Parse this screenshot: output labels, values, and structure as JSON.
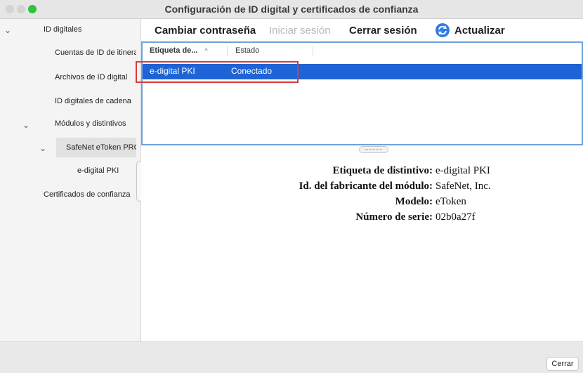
{
  "window": {
    "title": "Configuración de ID digital y certificados de confianza"
  },
  "sidebar": {
    "items": [
      {
        "label": "ID digitales",
        "expanded": true
      },
      {
        "label": "Cuentas de ID de itinerancia"
      },
      {
        "label": "Archivos de ID digital"
      },
      {
        "label": "ID digitales de cadena"
      },
      {
        "label": "Módulos y distintivos",
        "expanded": true
      },
      {
        "label": "SafeNet eToken PRO",
        "expanded": true,
        "selected": true
      },
      {
        "label": "e-digital PKI"
      },
      {
        "label": "Certificados de confianza"
      }
    ],
    "icons": {
      "expanded": "chevron-down-icon"
    }
  },
  "toolbar": {
    "change_password": "Cambiar contraseña",
    "login": "Iniciar sesión",
    "logout": "Cerrar sesión",
    "refresh": "Actualizar"
  },
  "table": {
    "columns": [
      "Etiqueta de...",
      "Estado"
    ],
    "rows": [
      {
        "label": "e-digital PKI",
        "status": "Conectado"
      }
    ]
  },
  "details": {
    "rows": [
      {
        "label": "Etiqueta de distintivo:",
        "value": "e-digital PKI"
      },
      {
        "label": "Id. del fabricante del módulo:",
        "value": "SafeNet, Inc."
      },
      {
        "label": "Modelo:",
        "value": "eToken"
      },
      {
        "label": "Número de serie:",
        "value": "02b0a27f"
      }
    ]
  },
  "footer": {
    "close": "Cerrar"
  },
  "colors": {
    "selection": "#1f64d6",
    "highlight_border": "#d63b3b",
    "panel_border": "#6ea2dc"
  }
}
